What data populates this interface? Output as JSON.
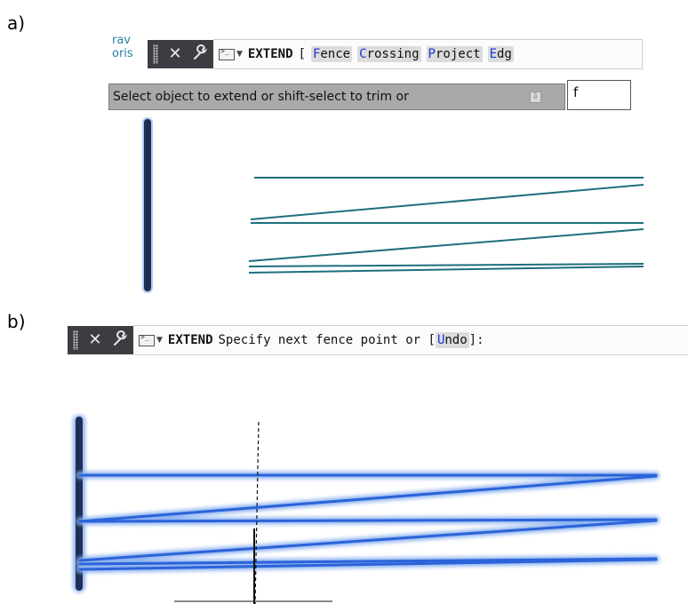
{
  "labels": {
    "panel_a": "a)",
    "panel_b": "b)"
  },
  "panel_a": {
    "background_snippet": [
      "rav",
      "oris"
    ],
    "command_bar": {
      "command": "EXTEND",
      "bracket": "[",
      "options": [
        {
          "hotkey": "F",
          "rest": "ence"
        },
        {
          "hotkey": "C",
          "rest": "rossing"
        },
        {
          "hotkey": "P",
          "rest": "roject"
        },
        {
          "hotkey": "E",
          "rest": "dg"
        }
      ]
    },
    "tooltip": "Select object to extend or shift-select to trim or",
    "input_value": "f"
  },
  "panel_b": {
    "command_bar": {
      "command": "EXTEND",
      "prompt": "Specify next fence point or [",
      "option": {
        "hotkey": "U",
        "rest": "ndo"
      },
      "suffix": "]:"
    }
  },
  "colors": {
    "line": "#1e6e7e",
    "selected": "#2b63d9",
    "boundary": "#1e2f55",
    "highlight": "#8fb4f0",
    "bar": "#3b3d42"
  },
  "icons": [
    "grip-icon",
    "close-icon",
    "wrench-icon",
    "command-prompt-icon",
    "dropdown-arrow-icon",
    "tooltip-expand-icon"
  ]
}
